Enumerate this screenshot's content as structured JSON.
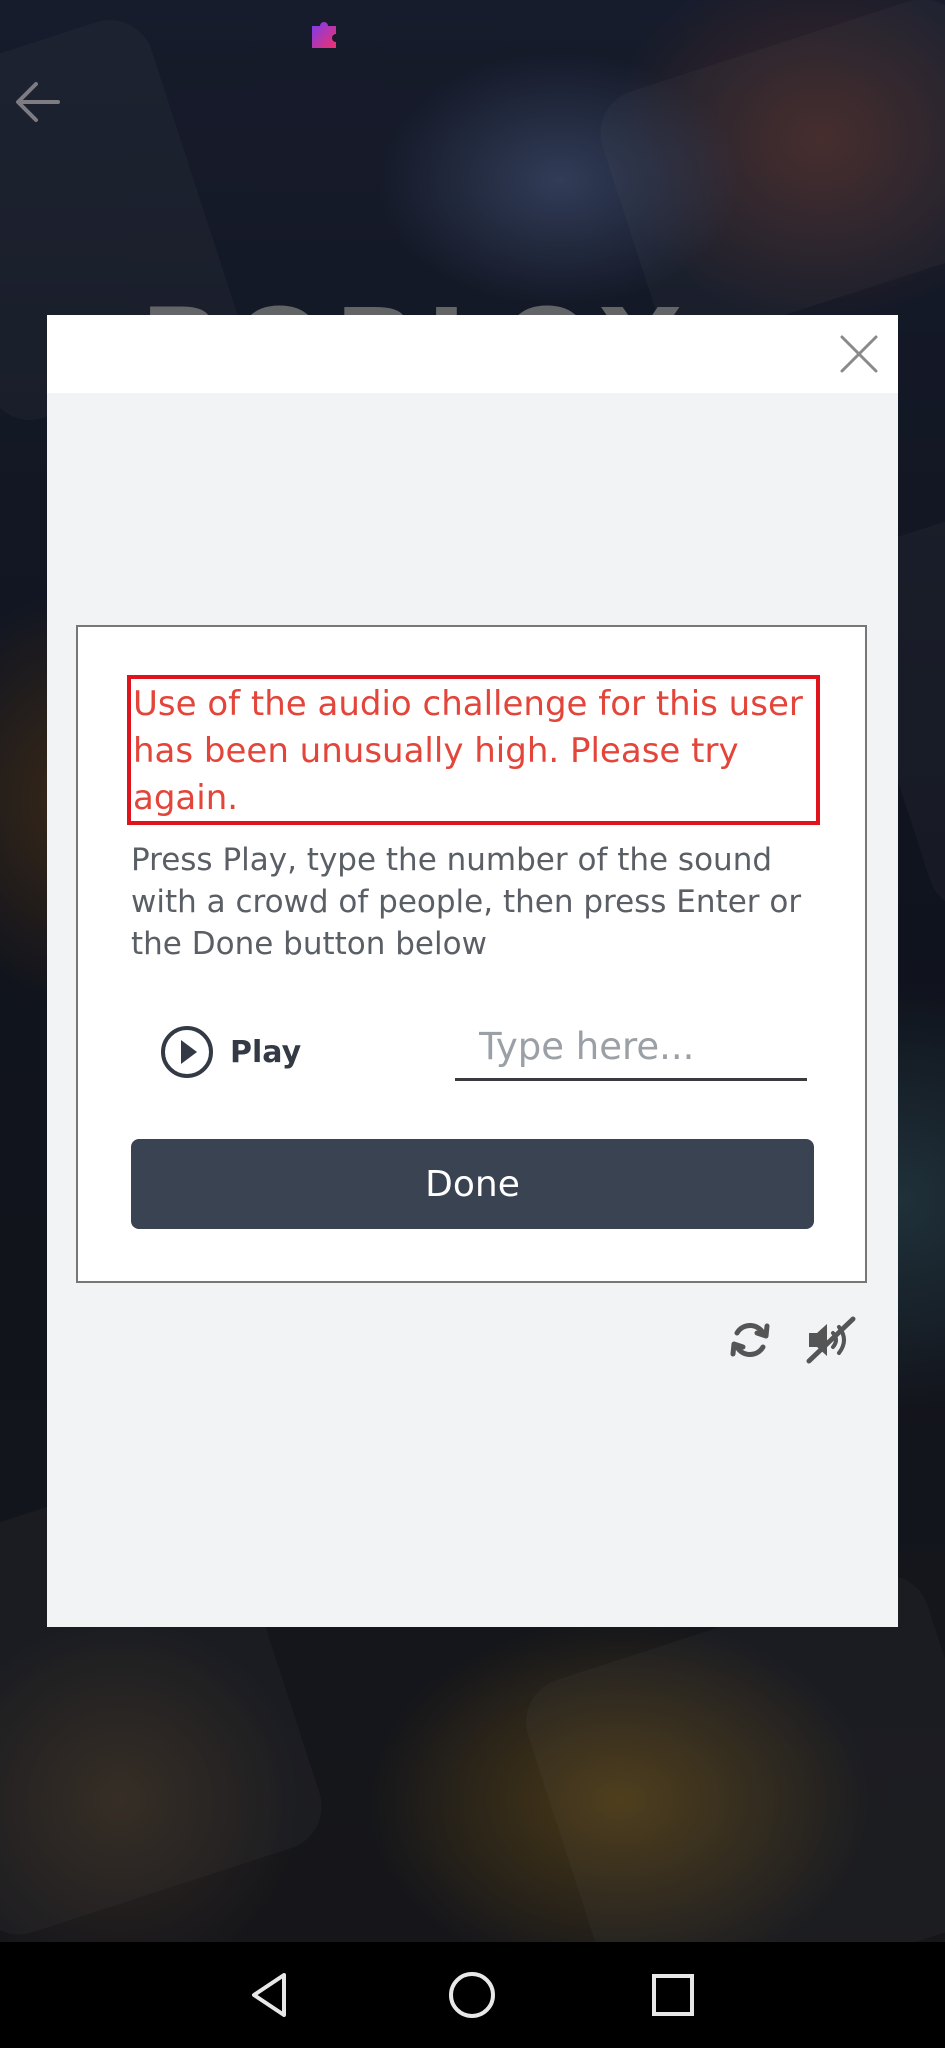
{
  "status_bar": {
    "left_text": "",
    "right_text": ""
  },
  "background": {
    "logo_text": "ROBLOX"
  },
  "challenge": {
    "error_message": "Use of the audio challenge for this user has been unusually high. Please try again.",
    "instructions": "Press Play, type the number of the sound with a crowd of people, then press Enter or the Done button below",
    "play_label": "Play",
    "input_placeholder": "Type here...",
    "input_value": "",
    "done_label": "Done"
  },
  "colors": {
    "error": "#e3453a",
    "error_border": "#e0121b",
    "done_button": "#394351"
  },
  "icons": {
    "close": "close-icon",
    "play": "play-circle-icon",
    "refresh": "refresh-icon",
    "audio_off": "audio-off-icon",
    "nav_back": "nav-back-icon",
    "nav_home": "nav-home-icon",
    "nav_recents": "nav-recents-icon"
  }
}
